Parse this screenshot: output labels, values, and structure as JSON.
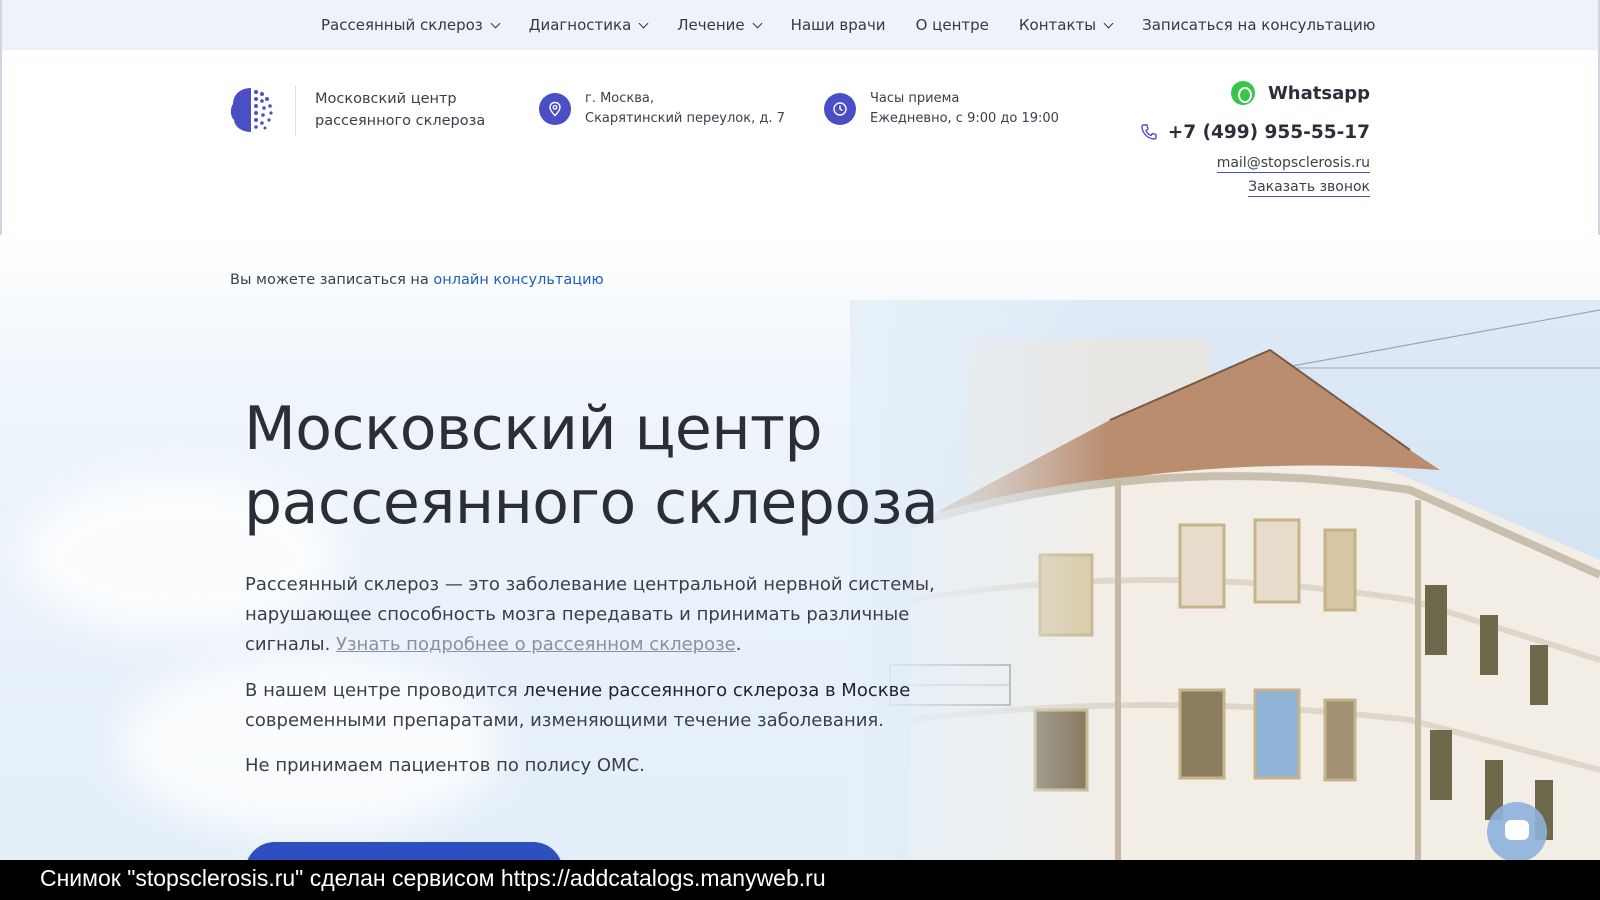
{
  "nav": {
    "items": [
      {
        "label": "Рассеянный склероз",
        "has_dropdown": true
      },
      {
        "label": "Диагностика",
        "has_dropdown": true
      },
      {
        "label": "Лечение",
        "has_dropdown": true
      },
      {
        "label": "Наши врачи",
        "has_dropdown": false
      },
      {
        "label": "О центре",
        "has_dropdown": false
      },
      {
        "label": "Контакты",
        "has_dropdown": true
      },
      {
        "label": "Записаться на консультацию",
        "has_dropdown": false
      }
    ]
  },
  "header": {
    "logo_line1": "Московский центр",
    "logo_line2": "рассеянного склероза",
    "address_line1": "г. Москва,",
    "address_line2": "Скарятинский переулок, д. 7",
    "hours_line1": "Часы приема",
    "hours_line2": "Ежедневно, с 9:00 до 19:00",
    "whatsapp": "Whatsapp",
    "phone": "+7 (499) 955-55-17",
    "email": "mail@stopsclerosis.ru",
    "callback": "Заказать звонок"
  },
  "hero": {
    "consult_prefix": "Вы можете записаться на ",
    "consult_link": "онлайн консультацию",
    "title_line1": "Московский центр",
    "title_line2": "рассеянного склероза",
    "p1_text": "Рассеянный склероз — это заболевание центральной нервной системы, нарушающее способность мозга передавать и принимать различные сигналы. ",
    "p1_link": "Узнать подробнее о рассеянном склерозе",
    "p1_end": ".",
    "p2_prefix": "В нашем центре проводится ",
    "p2_bold": "лечение рассеянного склероза в Москве",
    "p2_suffix": " современными препаратами, изменяющими течение заболевания.",
    "p3": "Не принимаем пациентов по полису ОМС."
  },
  "footer_caption": "Снимок \"stopsclerosis.ru\" сделан сервисом https://addcatalogs.manyweb.ru",
  "colors": {
    "accent": "#4b4fc4",
    "link": "#1f5fb8",
    "whatsapp": "#37c64a",
    "button": "#2d4fc0"
  }
}
